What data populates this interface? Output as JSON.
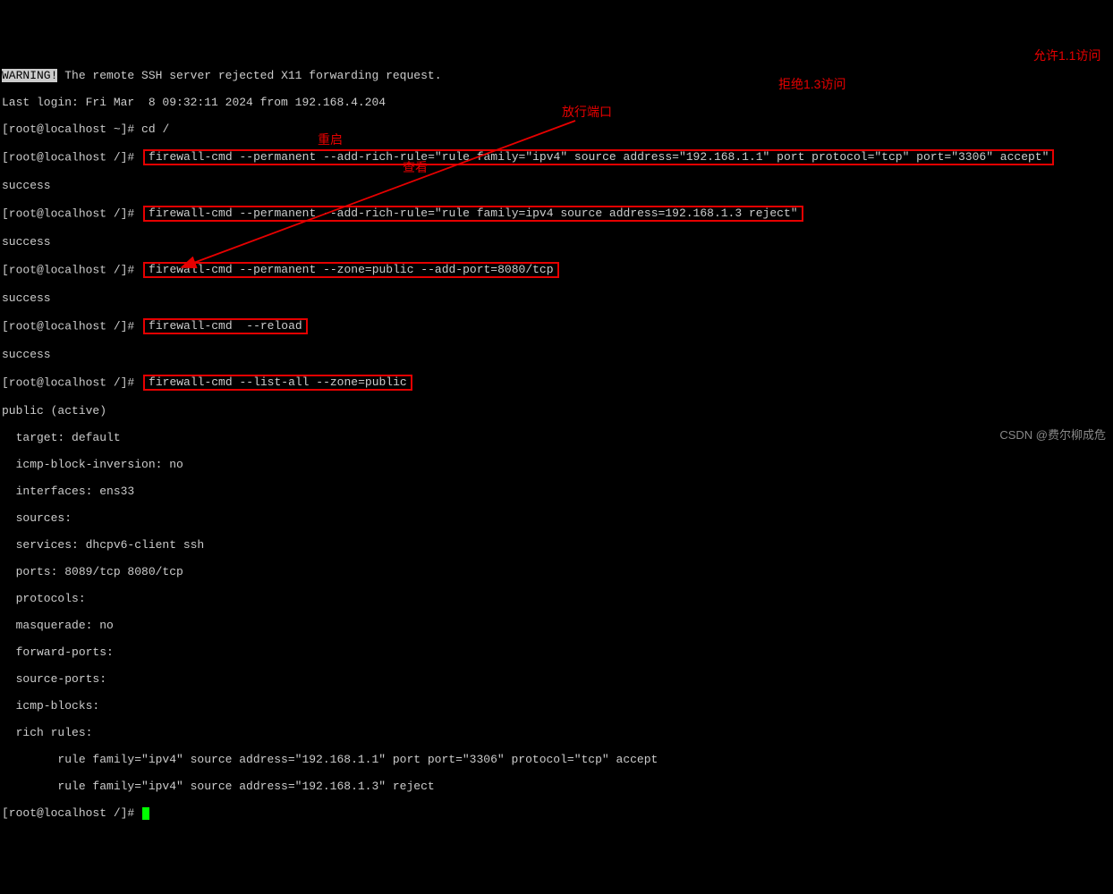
{
  "warn_tag": "WARNING!",
  "warn_msg": " The remote SSH server rejected X11 forwarding request.",
  "last_login": "Last login: Fri Mar  8 09:32:11 2024 from 192.168.4.204",
  "prompt_home": "[root@localhost ~]#",
  "prompt_root": "[root@localhost /]#",
  "cd_cmd": " cd /",
  "success": "success",
  "cmds": {
    "rule1": "firewall-cmd --permanent --add-rich-rule=\"rule family=\"ipv4\" source address=\"192.168.1.1\" port protocol=\"tcp\" port=\"3306\" accept\"",
    "rule2": "firewall-cmd --permanent --add-rich-rule=\"rule family=ipv4 source address=192.168.1.3 reject\"",
    "port": "firewall-cmd --permanent --zone=public --add-port=8080/tcp",
    "reload": "firewall-cmd  --reload",
    "list": "firewall-cmd --list-all --zone=public"
  },
  "ann": {
    "allow": "允许1.1访问",
    "reject": "拒绝1.3访问",
    "port": "放行端口",
    "reload": "重启",
    "list": "查看"
  },
  "output": {
    "head": "public (active)",
    "target": "  target: default",
    "icmpinv": "  icmp-block-inversion: no",
    "iface": "  interfaces: ens33",
    "sources": "  sources:",
    "services": "  services: dhcpv6-client ssh",
    "ports": "  ports: 8089/tcp 8080/tcp",
    "proto": "  protocols:",
    "masq": "  masquerade: no",
    "fwd": "  forward-ports:",
    "srcports": "  source-ports:",
    "icmpblk": "  icmp-blocks:",
    "rich": "  rich rules:",
    "r1": "        rule family=\"ipv4\" source address=\"192.168.1.1\" port port=\"3306\" protocol=\"tcp\" accept",
    "r2": "        rule family=\"ipv4\" source address=\"192.168.1.3\" reject"
  },
  "watermark": "CSDN @费尔柳成危"
}
